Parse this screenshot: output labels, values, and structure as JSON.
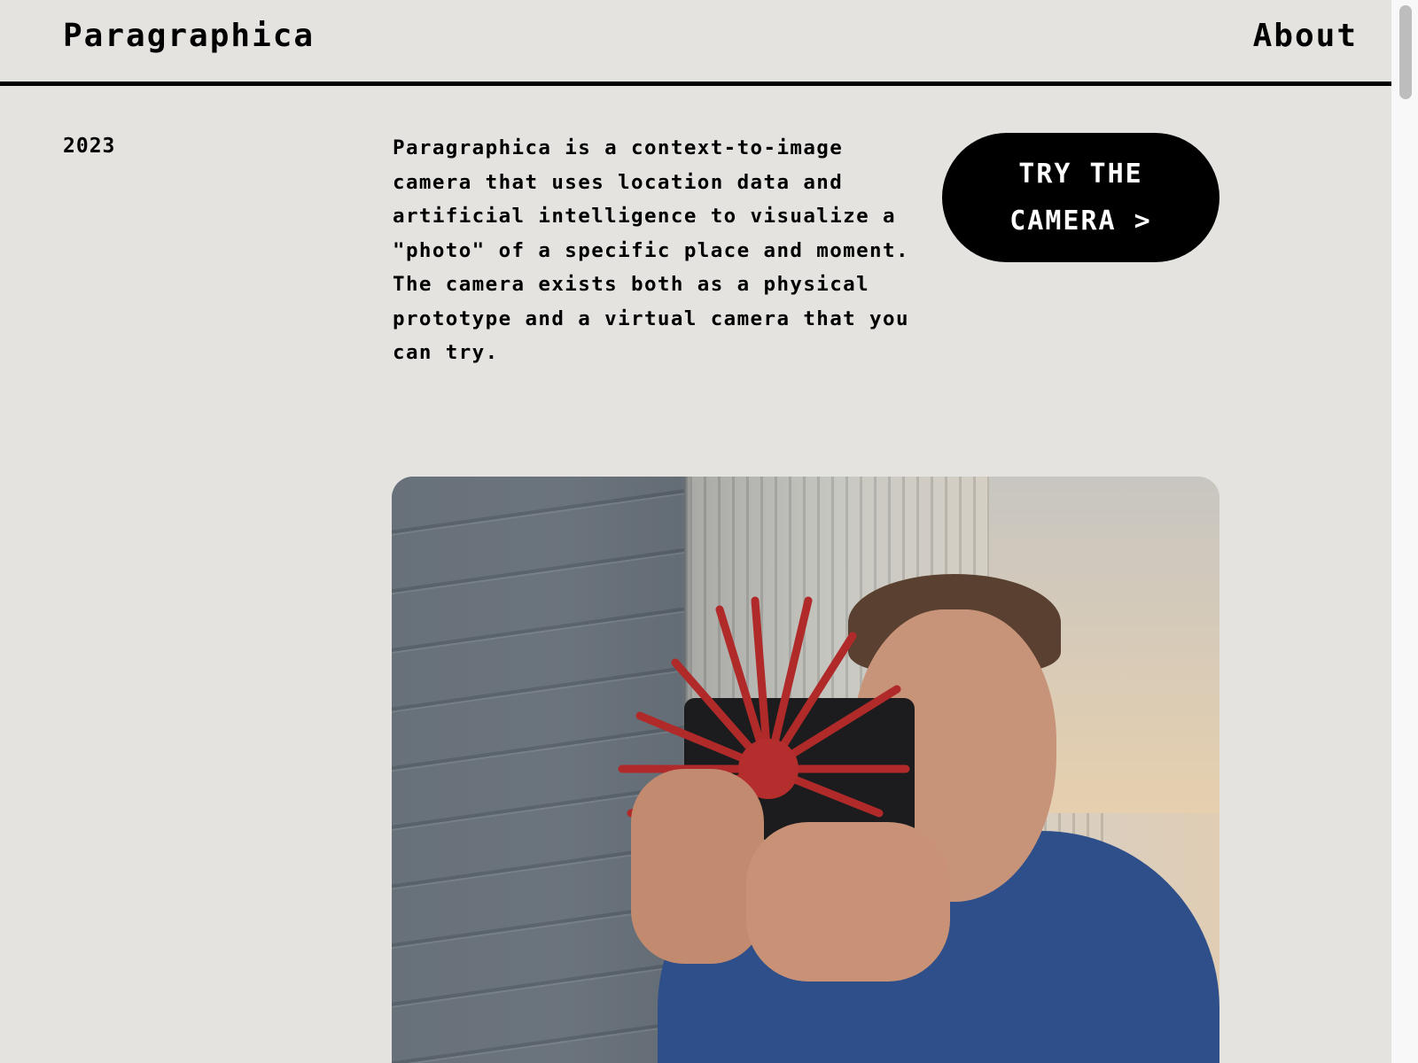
{
  "header": {
    "logo": "Paragraphica",
    "about_link": "About"
  },
  "intro": {
    "year": "2023",
    "description": "Paragraphica is a context-to-image camera that uses location data and artificial intelligence to visualize a \"photo\" of a specific place and moment. The camera exists both as a physical prototype and a virtual camera that you can try.",
    "cta_line1": "TRY THE",
    "cta_line2": "CAMERA >"
  },
  "colors": {
    "background": "#e4e3df",
    "text": "#000000",
    "button": "#000000",
    "button_text": "#ffffff"
  }
}
